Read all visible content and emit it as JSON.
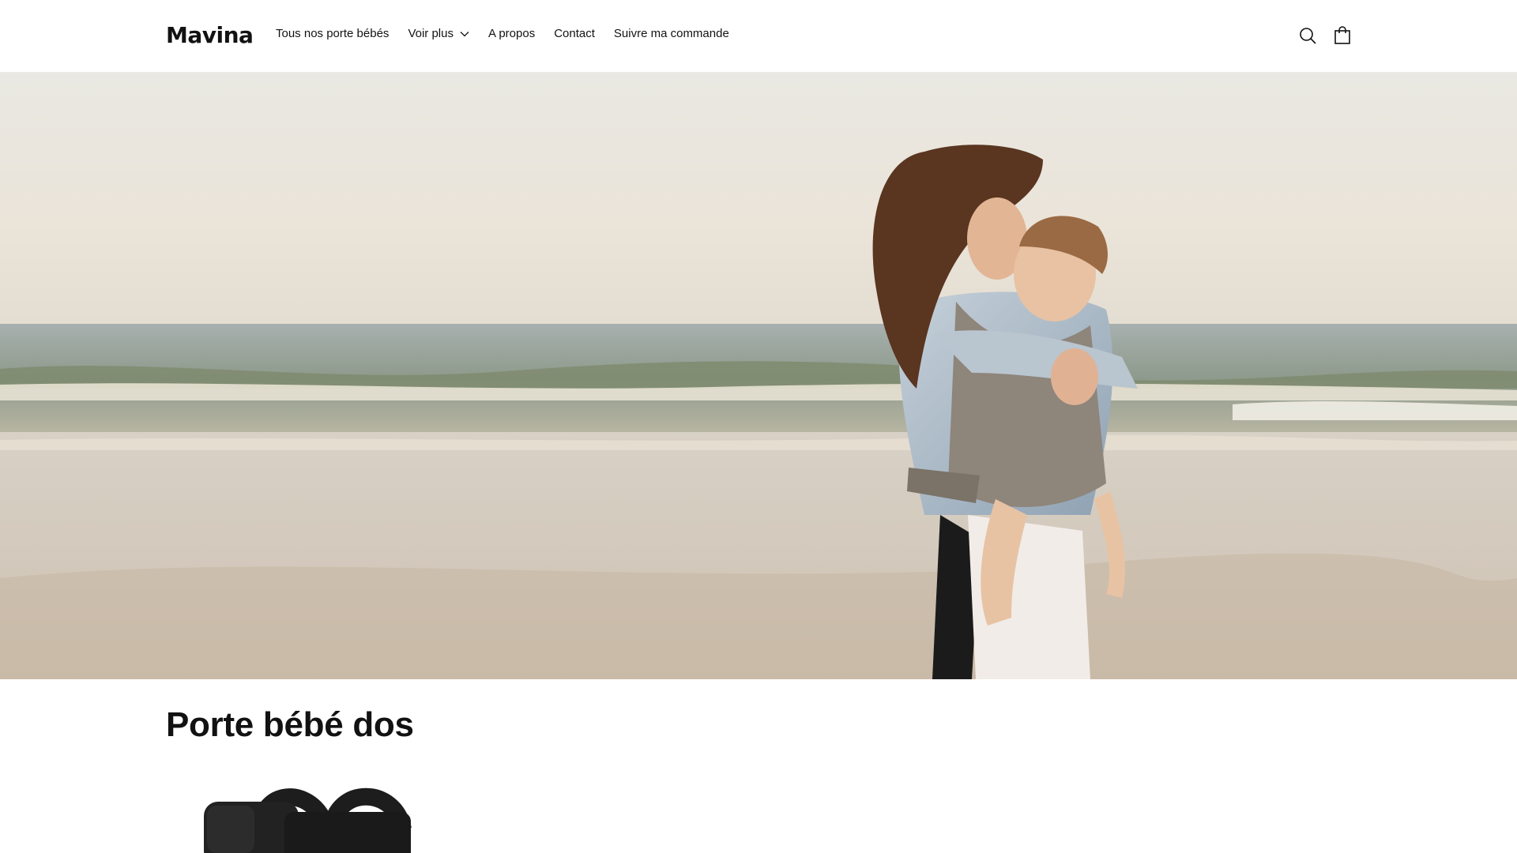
{
  "header": {
    "logo": "Mavina",
    "nav": [
      {
        "label": "Tous nos porte bébés"
      },
      {
        "label": "Voir plus",
        "has_dropdown": true
      },
      {
        "label": "A propos"
      },
      {
        "label": "Contact"
      },
      {
        "label": "Suivre ma commande"
      }
    ],
    "icons": [
      "search-icon",
      "shopping-bag-icon"
    ]
  },
  "hero": {
    "image": "mother-carrying-child-on-beach-photo"
  },
  "collection": {
    "title": "Porte bébé dos"
  },
  "products": [
    {
      "image": "black-baby-carrier-photo"
    }
  ],
  "colors": {
    "text": "#121212",
    "background": "#ffffff"
  }
}
